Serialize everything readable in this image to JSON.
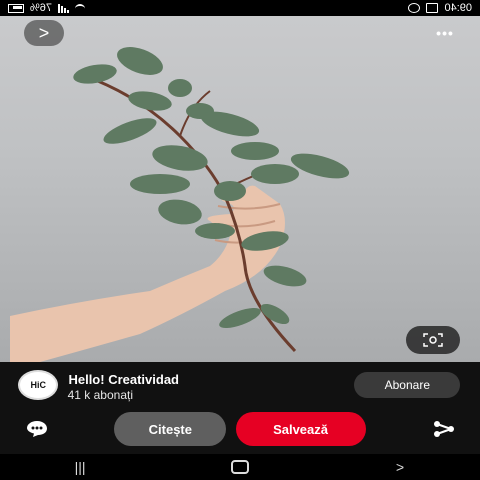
{
  "status_bar": {
    "time": "09:40",
    "battery": "76%"
  },
  "top_bar": {
    "more_icon": "more-dots-icon",
    "back_icon": "chevron-left-icon"
  },
  "pin": {
    "image_subject": "hand holding eucalyptus branch",
    "lens_icon": "visual-search-icon"
  },
  "creator": {
    "name": "Hello! Creatividad",
    "subscribers": "41 k abonați",
    "avatar_text": "HiC",
    "follow_label": "Abonare"
  },
  "actions": {
    "read_label": "Citește",
    "save_label": "Salvează",
    "comment_icon": "comment-icon",
    "share_icon": "share-icon"
  },
  "nav": {
    "back": "back-nav-icon",
    "home": "home-nav-icon",
    "recents": "recents-nav-icon"
  },
  "colors": {
    "save_red": "#e60023",
    "read_gray": "#5f5f5f",
    "dark": "#111111"
  }
}
